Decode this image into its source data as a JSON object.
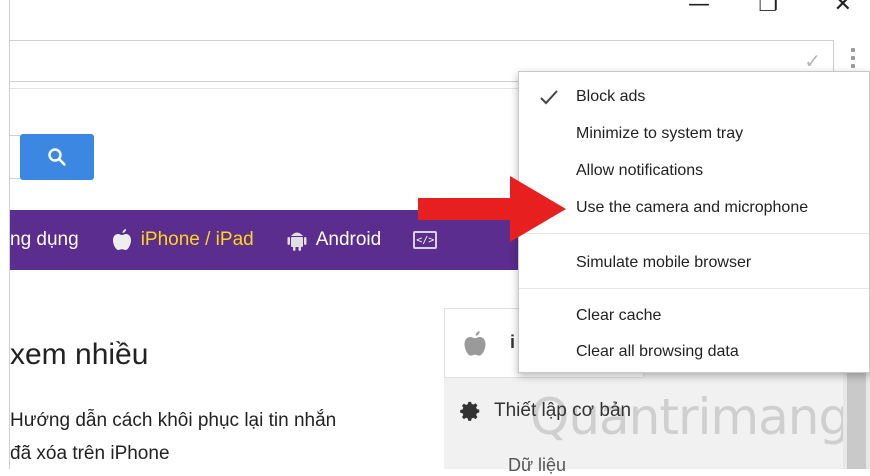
{
  "window": {
    "minimize_glyph": "—",
    "maximize_glyph": "❐",
    "close_glyph": "✕"
  },
  "address_bar": {
    "check_icon": "check-icon",
    "menu_icon": "kebab-menu-icon"
  },
  "search": {
    "button_icon": "search-icon"
  },
  "nav": {
    "items": [
      {
        "label": "ng dụng",
        "icon": null,
        "color": "#ffffff"
      },
      {
        "label": "iPhone / iPad",
        "icon": "apple-icon",
        "color": "#ffd51a"
      },
      {
        "label": "Android",
        "icon": "android-icon",
        "color": "#ffffff"
      },
      {
        "label": "",
        "icon": "code-icon",
        "color": "#ffffff"
      }
    ],
    "background": "#5b2d8e"
  },
  "main": {
    "heading": "xem nhiều",
    "article_lines": [
      "Hướng dẫn cách khôi phục lại tin nhắn",
      "đã xóa trên iPhone"
    ]
  },
  "side_panel": {
    "top_letter": "i",
    "row_label": "Thiết lập cơ bản",
    "row2_label": "Dữ liệu",
    "watermark": "Quantrimang"
  },
  "context_menu": {
    "items": [
      {
        "label": "Block ads",
        "checked": true
      },
      {
        "label": "Minimize to system tray",
        "checked": false
      },
      {
        "label": "Allow notifications",
        "checked": false
      },
      {
        "label": "Use the camera and microphone",
        "checked": false
      },
      {
        "label": "Simulate mobile browser",
        "checked": false
      },
      {
        "label": "Clear cache",
        "checked": false
      },
      {
        "label": "Clear all browsing data",
        "checked": false
      }
    ]
  },
  "colors": {
    "accent_blue": "#3c87e1",
    "arrow_red": "#e81f1f",
    "nav_purple": "#5b2d8e",
    "highlight_yellow": "#ffd51a"
  }
}
